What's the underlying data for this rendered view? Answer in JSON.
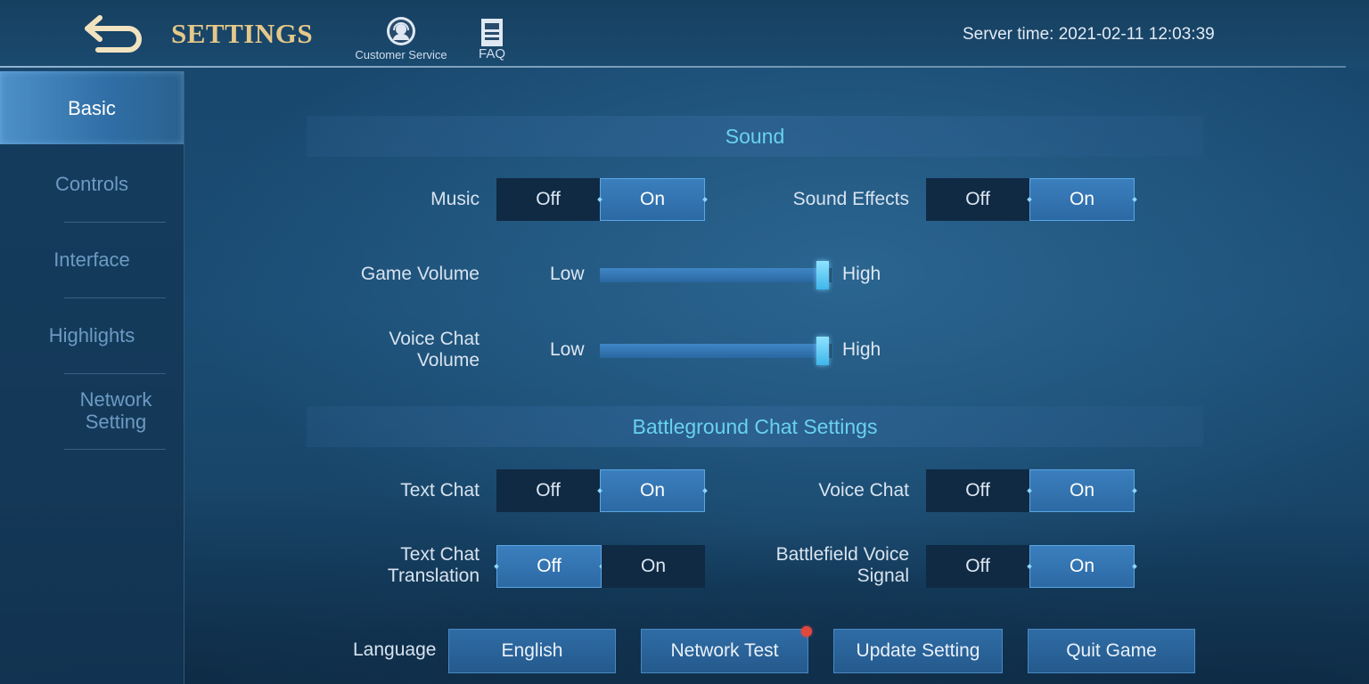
{
  "header": {
    "title": "SETTINGS",
    "customer_service_label": "Customer Service",
    "faq_label": "FAQ",
    "server_time": "Server time: 2021-02-11 12:03:39"
  },
  "sidebar": {
    "items": [
      {
        "label": "Basic",
        "active": true
      },
      {
        "label": "Controls",
        "active": false
      },
      {
        "label": "Interface",
        "active": false
      },
      {
        "label": "Highlights",
        "active": false
      },
      {
        "label": "Network Setting",
        "active": false
      }
    ]
  },
  "sound": {
    "header": "Sound",
    "music": {
      "label": "Music",
      "off": "Off",
      "on": "On",
      "value": "On"
    },
    "sound_effects": {
      "label": "Sound Effects",
      "off": "Off",
      "on": "On",
      "value": "On"
    },
    "game_volume": {
      "label": "Game Volume",
      "low": "Low",
      "high": "High",
      "level": 1.0
    },
    "voice_chat_volume": {
      "label": "Voice Chat Volume",
      "low": "Low",
      "high": "High",
      "level": 1.0
    }
  },
  "battleground_chat": {
    "header": "Battleground Chat Settings",
    "text_chat": {
      "label": "Text Chat",
      "off": "Off",
      "on": "On",
      "value": "On"
    },
    "voice_chat": {
      "label": "Voice Chat",
      "off": "Off",
      "on": "On",
      "value": "On"
    },
    "text_chat_translation": {
      "label": "Text Chat Translation",
      "off": "Off",
      "on": "On",
      "value": "Off"
    },
    "battlefield_voice_signal": {
      "label": "Battlefield Voice Signal",
      "off": "Off",
      "on": "On",
      "value": "On"
    }
  },
  "footer": {
    "language_label": "Language",
    "language_value": "English",
    "network_test": "Network Test",
    "update_setting": "Update Setting",
    "quit_game": "Quit Game"
  },
  "colors": {
    "title_gold": "#e5c88a",
    "section_header_text": "#69d2ee",
    "toggle_selected": "#2c69a4",
    "notification_dot": "#e0473d"
  },
  "icons": {
    "back": "back-arrow-icon",
    "customer_service": "headset-icon",
    "faq": "document-icon"
  }
}
